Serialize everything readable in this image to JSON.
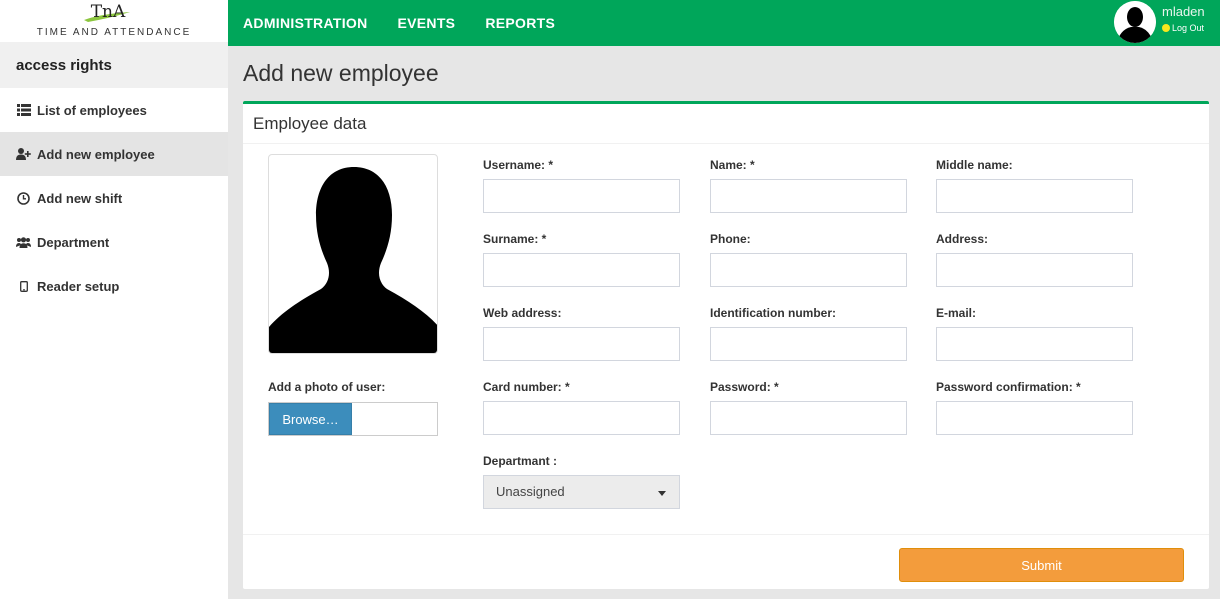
{
  "logo": {
    "mark": "TnA",
    "text": "TIME AND ATTENDANCE"
  },
  "sidebar": {
    "section_title": "access rights",
    "items": [
      {
        "label": "List of employees",
        "icon": "list-icon",
        "active": false
      },
      {
        "label": "Add new employee",
        "icon": "user-plus-icon",
        "active": true
      },
      {
        "label": "Add new shift",
        "icon": "clock-icon",
        "active": false
      },
      {
        "label": "Department",
        "icon": "users-icon",
        "active": false
      },
      {
        "label": "Reader setup",
        "icon": "tablet-icon",
        "active": false
      }
    ]
  },
  "topbar": {
    "nav": [
      "ADMINISTRATION",
      "EVENTS",
      "REPORTS"
    ],
    "user": {
      "name": "mladen",
      "logout": "Log Out"
    }
  },
  "page": {
    "title": "Add new employee"
  },
  "form": {
    "header": "Employee data",
    "photo_label": "Add a photo of user:",
    "browse_label": "Browse…",
    "fields": {
      "username": {
        "label": "Username: *",
        "value": ""
      },
      "name": {
        "label": "Name: *",
        "value": ""
      },
      "middle_name": {
        "label": "Middle name:",
        "value": ""
      },
      "surname": {
        "label": "Surname: *",
        "value": ""
      },
      "phone": {
        "label": "Phone:",
        "value": ""
      },
      "address": {
        "label": "Address:",
        "value": ""
      },
      "web_address": {
        "label": "Web address:",
        "value": ""
      },
      "identification_number": {
        "label": "Identification number:",
        "value": ""
      },
      "email": {
        "label": "E-mail:",
        "value": ""
      },
      "card_number": {
        "label": "Card number: *",
        "value": ""
      },
      "password": {
        "label": "Password: *",
        "value": ""
      },
      "password_confirmation": {
        "label": "Password confirmation: *",
        "value": ""
      }
    },
    "department": {
      "label": "Departmant :",
      "selected": "Unassigned"
    },
    "submit_label": "Submit"
  },
  "colors": {
    "brand_green": "#00a65a",
    "submit_orange": "#f39c3c",
    "browse_blue": "#3c8dbc"
  }
}
